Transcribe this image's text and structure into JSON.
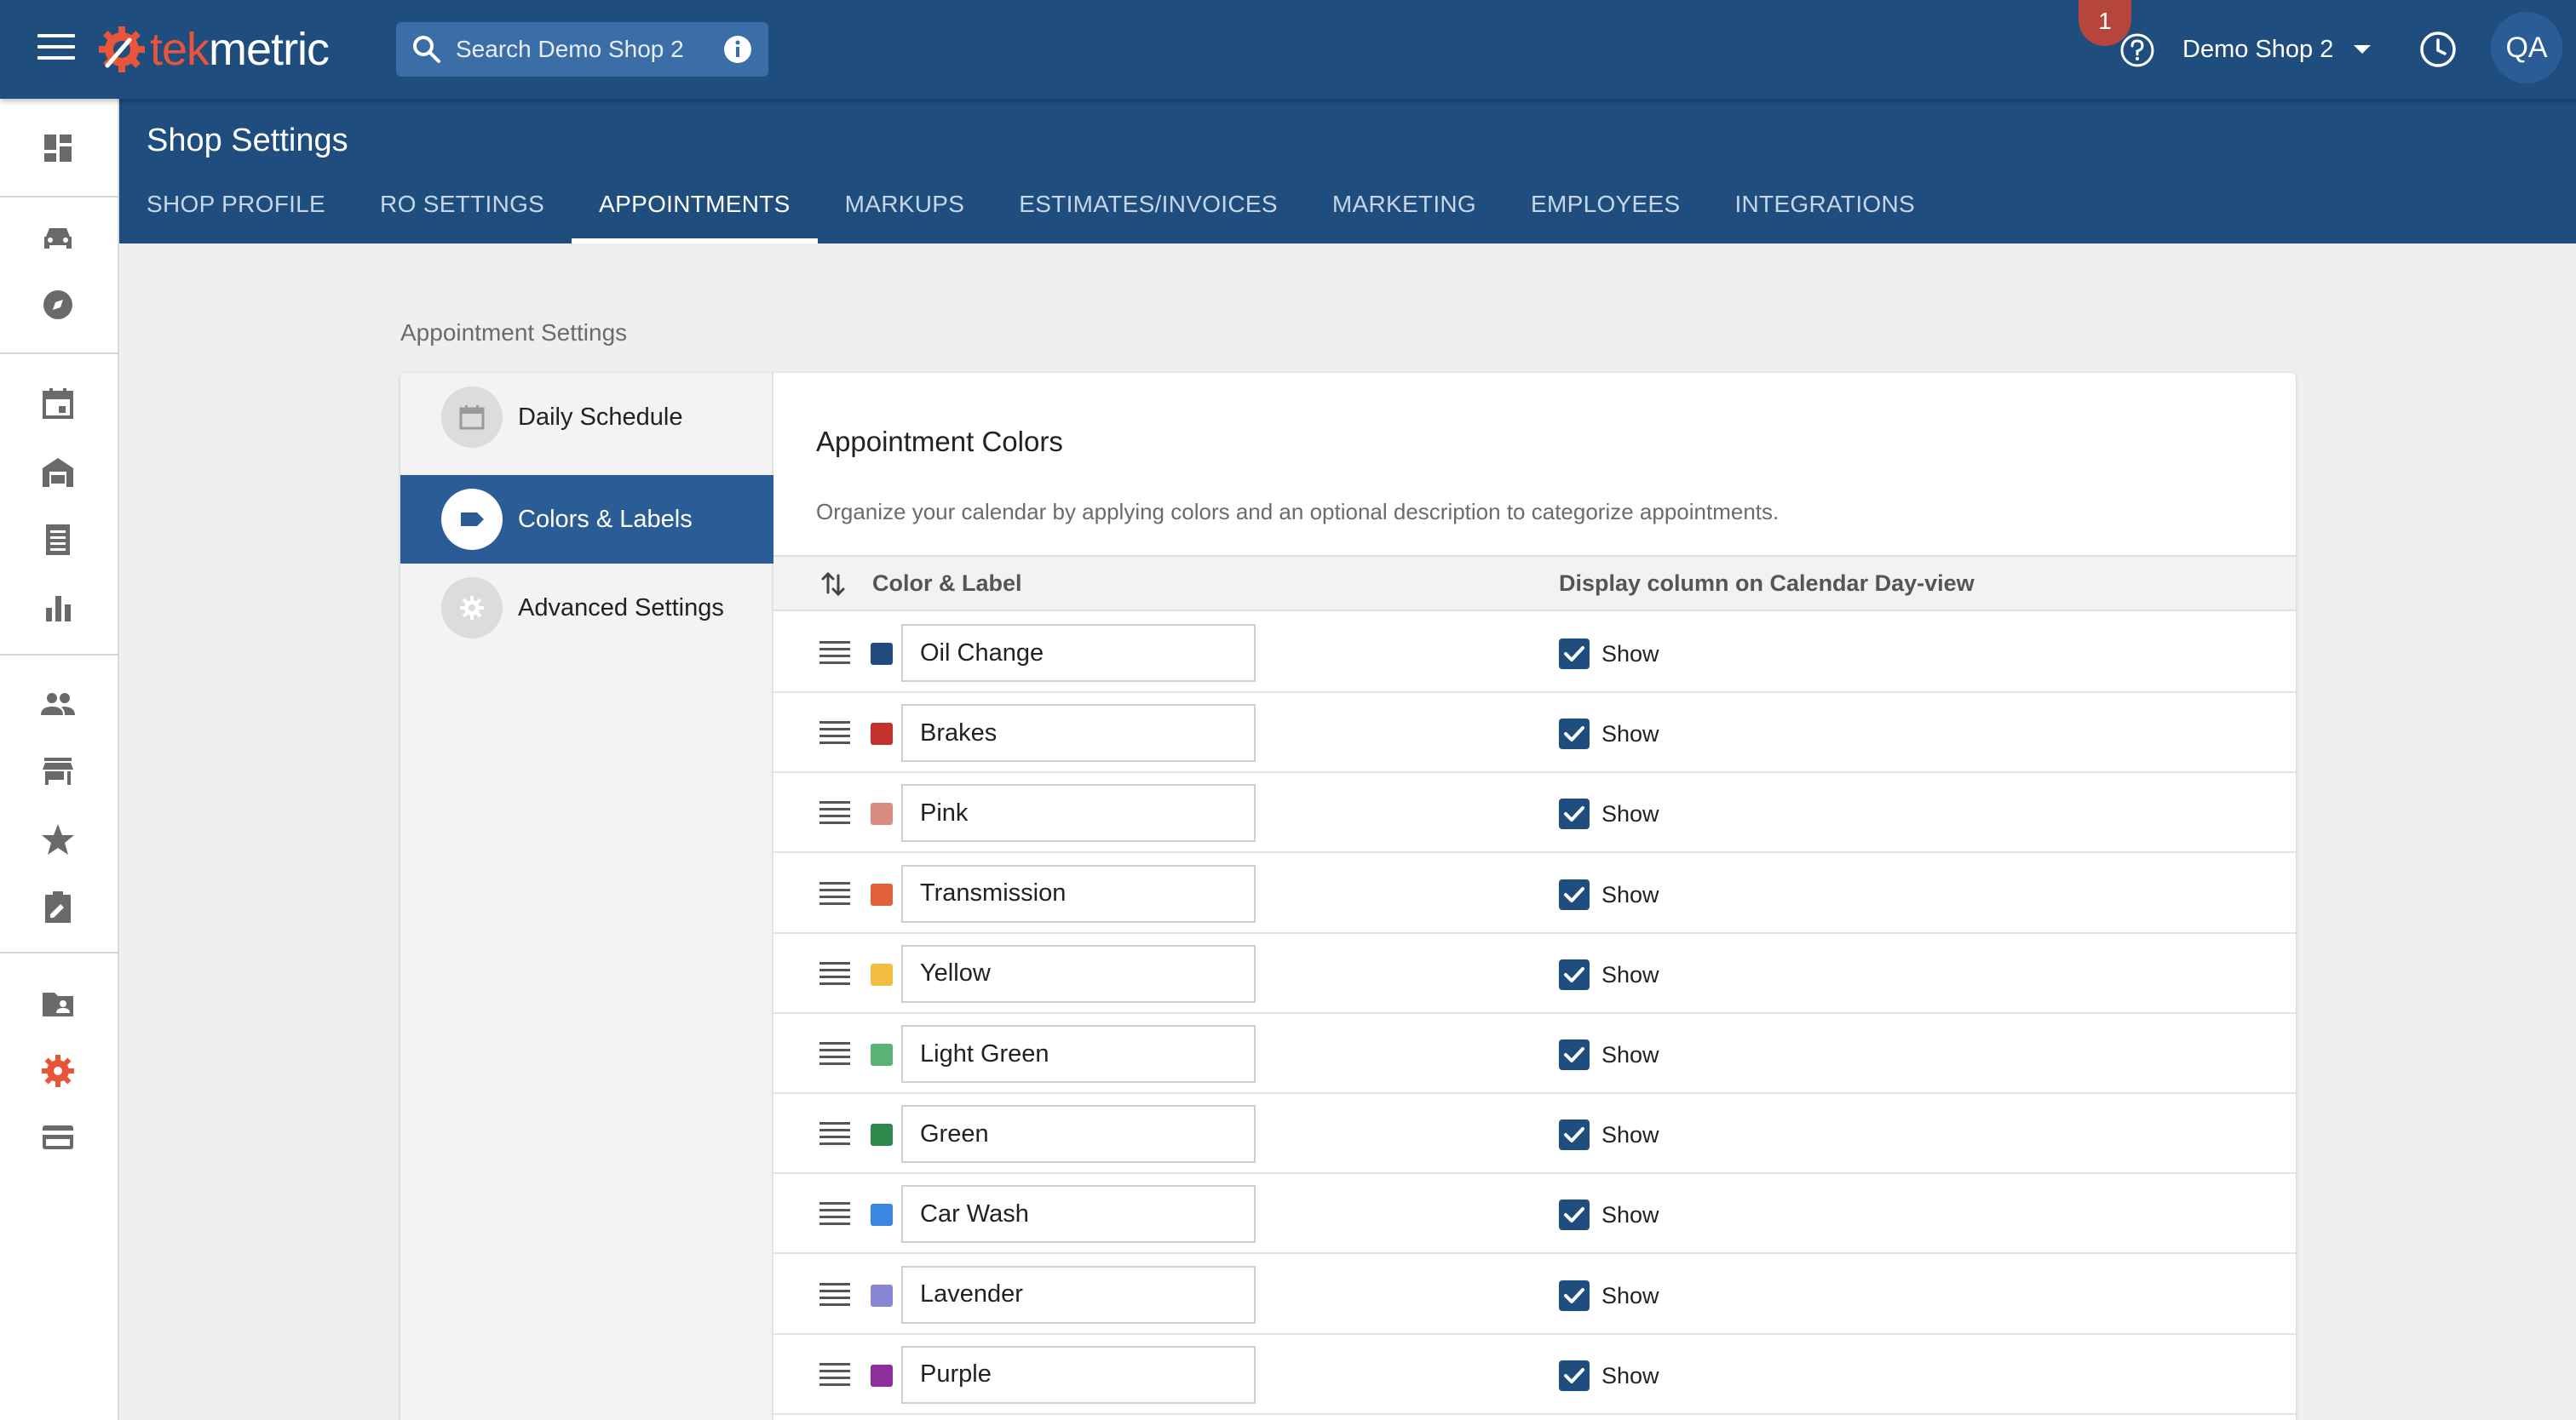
{
  "app": {
    "logo_prefix": "tek",
    "logo_suffix": "metric",
    "search_placeholder": "Search Demo Shop 2",
    "notification_count": "1",
    "shop_name": "Demo Shop 2",
    "user_initials": "QA"
  },
  "page": {
    "title": "Shop Settings",
    "tabs": [
      {
        "label": "SHOP PROFILE",
        "active": false
      },
      {
        "label": "RO SETTINGS",
        "active": false
      },
      {
        "label": "APPOINTMENTS",
        "active": true
      },
      {
        "label": "MARKUPS",
        "active": false
      },
      {
        "label": "ESTIMATES/INVOICES",
        "active": false
      },
      {
        "label": "MARKETING",
        "active": false
      },
      {
        "label": "EMPLOYEES",
        "active": false
      },
      {
        "label": "INTEGRATIONS",
        "active": false
      }
    ]
  },
  "rail": {
    "icons": [
      "dashboard-icon",
      "car-icon",
      "compass-icon",
      "calendar-icon",
      "garage-icon",
      "receipt-icon",
      "bar-chart-icon",
      "people-icon",
      "store-icon",
      "star-icon",
      "clipboard-icon",
      "folder-shared-icon",
      "settings-icon",
      "credit-card-icon"
    ],
    "active_icon": "settings-icon"
  },
  "settings": {
    "section_label": "Appointment Settings",
    "nav": [
      {
        "label": "Daily Schedule",
        "icon": "calendar-icon",
        "active": false
      },
      {
        "label": "Colors & Labels",
        "icon": "label-icon",
        "active": true
      },
      {
        "label": "Advanced Settings",
        "icon": "gear-icon",
        "active": false
      }
    ],
    "heading": "Appointment Colors",
    "description": "Organize your calendar by applying colors and an optional description to categorize appointments.",
    "columns": {
      "color_label": "Color & Label",
      "display": "Display column on Calendar Day-view"
    },
    "rows": [
      {
        "label": "Oil Change",
        "color": "#1f4d7e",
        "show": true,
        "show_label": "Show"
      },
      {
        "label": "Brakes",
        "color": "#c4302b",
        "show": true,
        "show_label": "Show"
      },
      {
        "label": "Pink",
        "color": "#d98b80",
        "show": true,
        "show_label": "Show"
      },
      {
        "label": "Transmission",
        "color": "#e4603a",
        "show": true,
        "show_label": "Show"
      },
      {
        "label": "Yellow",
        "color": "#f2be42",
        "show": true,
        "show_label": "Show"
      },
      {
        "label": "Light Green",
        "color": "#5bb276",
        "show": true,
        "show_label": "Show"
      },
      {
        "label": "Green",
        "color": "#2f8a4e",
        "show": true,
        "show_label": "Show"
      },
      {
        "label": "Car Wash",
        "color": "#3b87e0",
        "show": true,
        "show_label": "Show"
      },
      {
        "label": "Lavender",
        "color": "#8a86d6",
        "show": true,
        "show_label": "Show"
      },
      {
        "label": "Purple",
        "color": "#8e2fa0",
        "show": true,
        "show_label": "Show"
      }
    ]
  },
  "colors": {
    "brand_blue": "#1f4d7e",
    "brand_orange": "#e8553a"
  }
}
